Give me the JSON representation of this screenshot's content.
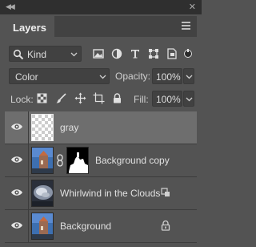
{
  "panel": {
    "tab_title": "Layers",
    "filter_kind": "Kind",
    "blend_mode": "Color",
    "opacity_label": "Opacity:",
    "opacity_value": "100%",
    "lock_label": "Lock:",
    "fill_label": "Fill:",
    "fill_value": "100%"
  },
  "filter_icons": [
    "image-filter-icon",
    "adjustment-filter-icon",
    "type-filter-icon",
    "shape-filter-icon",
    "smart-object-filter-icon",
    "filter-toggle-icon"
  ],
  "lock_icons": [
    "lock-transparent-pixels-icon",
    "lock-image-pixels-icon",
    "lock-position-icon",
    "lock-artboard-icon",
    "lock-all-icon"
  ],
  "layers": [
    {
      "name": "gray",
      "selected": true,
      "thumbnail": "transparent-checker",
      "badge": ""
    },
    {
      "name": "Background copy",
      "selected": false,
      "thumbnail": "photo-castle",
      "mask": true,
      "badge": ""
    },
    {
      "name": "Whirlwind in the Clouds",
      "selected": false,
      "thumbnail": "photo-clouds",
      "badge": "smart-object-icon"
    },
    {
      "name": "Background",
      "selected": false,
      "thumbnail": "photo-castle",
      "badge": "lock-icon"
    }
  ],
  "colors": {
    "panel_bg": "#535353",
    "selected_row": "#6e6e6e",
    "field_bg": "#414141"
  }
}
